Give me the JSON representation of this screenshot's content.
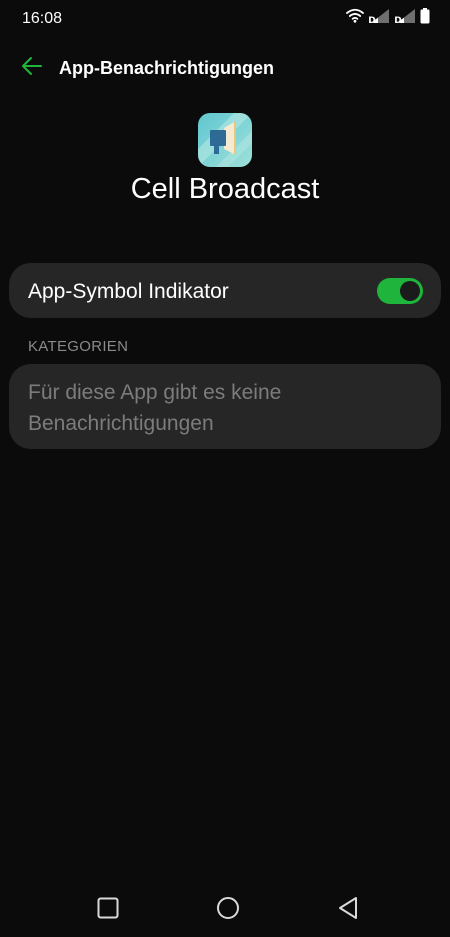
{
  "status_bar": {
    "time": "16:08",
    "icons": [
      "wifi-icon",
      "signal-1-icon",
      "signal-2-icon",
      "battery-icon"
    ]
  },
  "toolbar": {
    "back_icon": "back-arrow-icon",
    "title": "App-Benachrichtigungen"
  },
  "app": {
    "icon": "cell-broadcast-app-icon",
    "name": "Cell Broadcast"
  },
  "settings": {
    "app_badge": {
      "label": "App-Symbol Indikator",
      "enabled": true
    }
  },
  "categories": {
    "header": "KATEGORIEN",
    "empty_text": "Für diese App gibt es keine Benachrichtigungen"
  },
  "nav_bar": {
    "buttons": [
      "recent-apps-icon",
      "home-icon",
      "back-icon"
    ]
  },
  "colors": {
    "background": "#0b0b0b",
    "card": "#262626",
    "accent": "#1fb53c",
    "secondary_text": "#8a8a8a"
  }
}
